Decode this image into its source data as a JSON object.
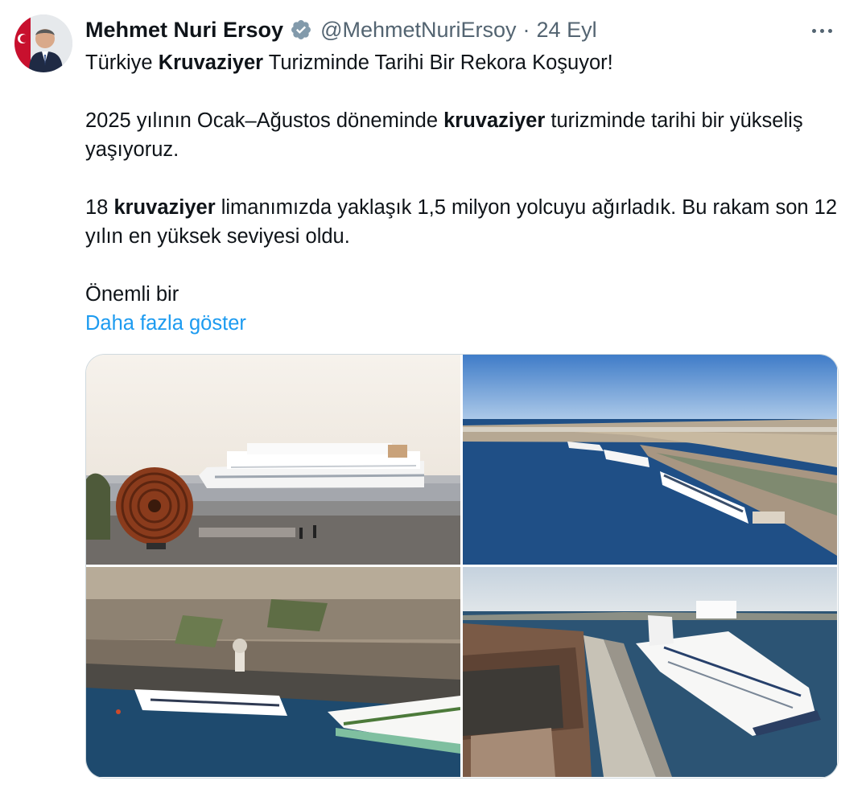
{
  "author": {
    "name": "Mehmet Nuri Ersoy",
    "handle": "@MehmetNuriErsoy",
    "separator": "·",
    "date": "24 Eyl",
    "avatar_icon": "avatar-portrait",
    "verified_icon": "verified-badge-icon"
  },
  "tweet": {
    "line1": {
      "a": "Türkiye ",
      "b": "Kruvaziyer",
      "c": " Turizminde Tarihi Bir Rekora Koşuyor!"
    },
    "line2": {
      "a": "2025 yılının Ocak–Ağustos döneminde ",
      "b": "kruvaziyer",
      "c": " turizminde tarihi bir yükseliş yaşıyoruz."
    },
    "line3": {
      "a": "18 ",
      "b": "kruvaziyer",
      "c": " limanımızda yaklaşık 1,5 milyon yolcuyu ağırladık. Bu rakam son 12 yılın en yüksek seviyesi oldu."
    },
    "line4": "Önemli bir",
    "show_more": "Daha fazla göster"
  },
  "media": [
    {
      "name": "cruise-ship-at-sea-with-sculpture"
    },
    {
      "name": "aerial-port-with-cruise-ships"
    },
    {
      "name": "aerial-city-waterfront-ships"
    },
    {
      "name": "docked-cruise-ship-pier"
    }
  ],
  "colors": {
    "accent": "#1d9bf0",
    "verified": "#829aab",
    "muted": "#536471"
  }
}
